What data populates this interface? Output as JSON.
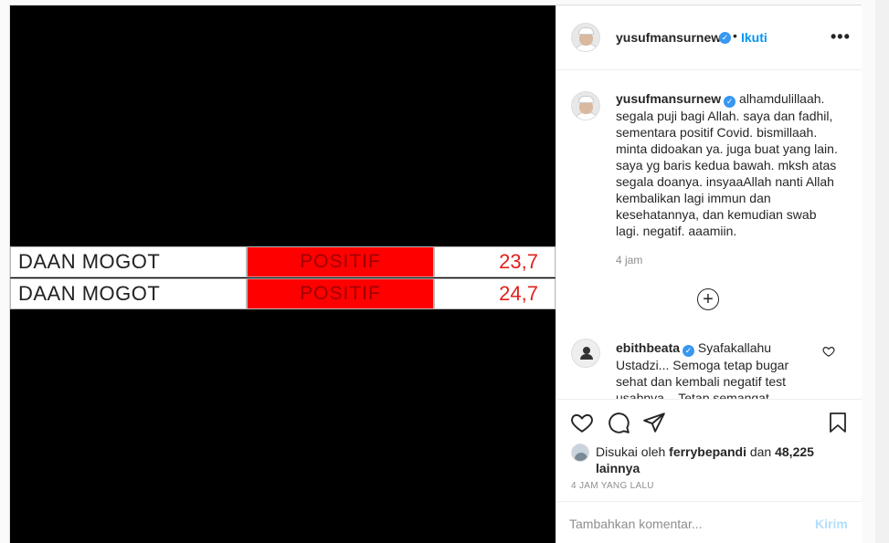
{
  "image_table": {
    "rows": [
      {
        "location": "DAAN MOGOT",
        "result": "POSITIF",
        "value": "23,7"
      },
      {
        "location": "DAAN MOGOT",
        "result": "POSITIF",
        "value": "24,7"
      }
    ]
  },
  "header": {
    "username": "yusufmansurnew",
    "verified_mark": "✓",
    "separator": "•",
    "follow_label": "Ikuti",
    "more_label": "•••"
  },
  "caption": {
    "username": "yusufmansurnew",
    "text": "alhamdulillaah. segala puji bagi Allah. saya dan fadhil, sementara positif Covid. bismillaah. minta didoakan ya. juga buat yang lain. saya yg baris kedua bawah. mksh atas segala doanya. insyaaAllah nanti Allah kembalikan lagi immun dan kesehatannya, dan kemudian swab lagi. negatif. aaamiin.",
    "time": "4 jam"
  },
  "load_more_label": "+",
  "comment": {
    "username": "ebithbeata",
    "text": "Syafakallahu Ustadzi... Semoga tetap bugar sehat dan kembali negatif test usabnya... Tetap semangat"
  },
  "likes": {
    "prefix": "Disukai oleh",
    "user": "ferrybepandi",
    "conj": "dan",
    "others": "48,225 lainnya"
  },
  "post_time": "4 JAM YANG LALU",
  "add_comment": {
    "placeholder": "Tambahkan komentar...",
    "post_label": "Kirim"
  },
  "colors": {
    "accent": "#0095f6",
    "verified": "#3897f0",
    "positive_cell": "#ff0000",
    "post_disabled": "#b2dffc"
  },
  "icons": [
    "verified-icon",
    "more-icon",
    "add-circle-icon",
    "heart-icon",
    "comment-icon",
    "share-icon",
    "bookmark-icon"
  ]
}
